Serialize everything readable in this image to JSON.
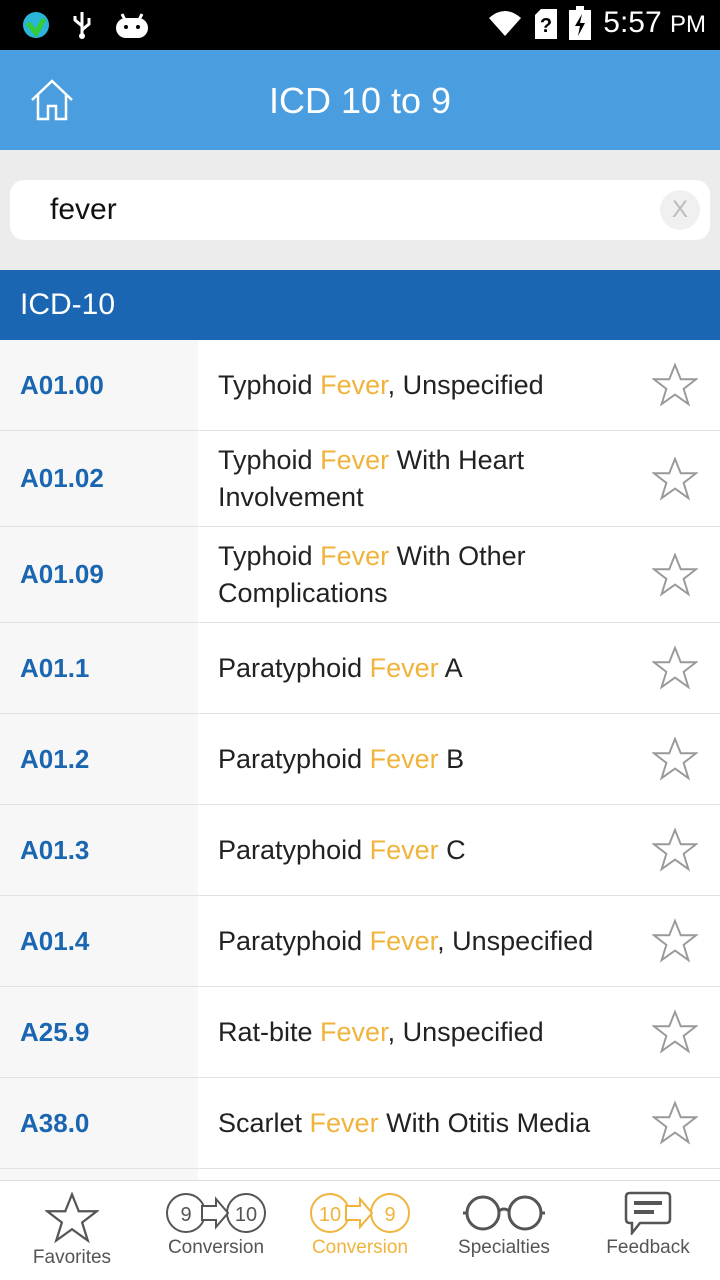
{
  "status_bar": {
    "time": "5:57",
    "ampm": "PM"
  },
  "app_bar": {
    "title": "ICD 10 to 9"
  },
  "search": {
    "value": "fever",
    "clear_label": "X"
  },
  "section": {
    "title": "ICD-10"
  },
  "colors": {
    "header": "#4a9ee0",
    "section": "#1a66b2",
    "code": "#1a66b0",
    "highlight": "#f0b43c"
  },
  "rows": [
    {
      "code": "A01.00",
      "pre": "Typhoid ",
      "hl": "Fever",
      "post": ", Unspecified",
      "h": 91
    },
    {
      "code": "A01.02",
      "pre": "Typhoid ",
      "hl": "Fever",
      "post": " With Heart Involvement",
      "h": 96
    },
    {
      "code": "A01.09",
      "pre": "Typhoid ",
      "hl": "Fever",
      "post": " With Other Complications",
      "h": 96
    },
    {
      "code": "A01.1",
      "pre": "Paratyphoid ",
      "hl": "Fever",
      "post": " A",
      "h": 91
    },
    {
      "code": "A01.2",
      "pre": "Paratyphoid ",
      "hl": "Fever",
      "post": " B",
      "h": 91
    },
    {
      "code": "A01.3",
      "pre": "Paratyphoid ",
      "hl": "Fever",
      "post": " C",
      "h": 91
    },
    {
      "code": "A01.4",
      "pre": "Paratyphoid ",
      "hl": "Fever",
      "post": ", Unspecified",
      "h": 91
    },
    {
      "code": "A25.9",
      "pre": "Rat-bite ",
      "hl": "Fever",
      "post": ", Unspecified",
      "h": 91
    },
    {
      "code": "A38.0",
      "pre": "Scarlet ",
      "hl": "Fever",
      "post": " With Otitis Media",
      "h": 91
    }
  ],
  "bottom_nav": [
    {
      "label": "Favorites",
      "icon": "star-icon"
    },
    {
      "label": "Conversion",
      "icon": "9-to-10-icon",
      "a": "9",
      "b": "10"
    },
    {
      "label": "Conversion",
      "icon": "10-to-9-icon",
      "a": "10",
      "b": "9",
      "active": true
    },
    {
      "label": "Specialties",
      "icon": "glasses-icon"
    },
    {
      "label": "Feedback",
      "icon": "feedback-icon"
    }
  ]
}
